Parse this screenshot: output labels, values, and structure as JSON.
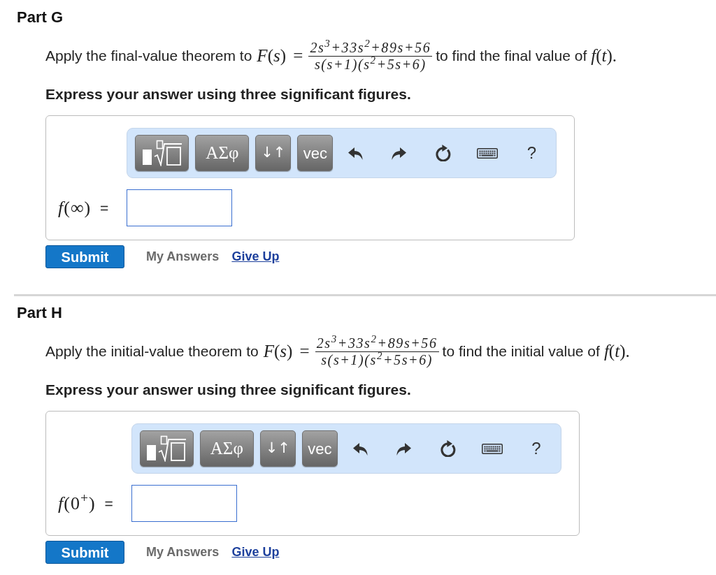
{
  "parts": [
    {
      "title": "Part G",
      "prompt": {
        "before": "Apply the final-value theorem to",
        "lhs": "*F*(*s*) =",
        "numerator": "2s$^{3}$+33s$^{2}$+89s+56",
        "denominator": "s(s+1)(s$^{2}$+5s+6)",
        "after": "to find the final value of",
        "target": "*f*(*t*)."
      },
      "instruction": "Express your answer using three significant figures.",
      "toolbar": [
        {
          "kind": "templates"
        },
        {
          "kind": "symbols",
          "label": "ΑΣφ"
        },
        {
          "kind": "arrows",
          "label": "↓↑"
        },
        {
          "kind": "vector",
          "label": "vec"
        },
        {
          "kind": "undo"
        },
        {
          "kind": "redo"
        },
        {
          "kind": "reset"
        },
        {
          "kind": "keyboard"
        },
        {
          "kind": "help",
          "label": "?"
        }
      ],
      "answer": {
        "label": "*f*(∞)",
        "relation": "="
      },
      "actions": [
        {
          "kind": "submit",
          "label": "Submit",
          "disabled": false
        },
        {
          "kind": "history",
          "label": "My Answers",
          "disabled": true
        },
        {
          "kind": "giveup",
          "label": "Give Up",
          "disabled": false
        }
      ]
    },
    {
      "title": "Part H",
      "prompt": {
        "before": "Apply the initial-value theorem to",
        "lhs": "*F*(*s*) =",
        "numerator": "2s$^{3}$+33s$^{2}$+89s+56",
        "denominator": "s(s+1)(s$^{2}$+5s+6)",
        "after": "to find the initial value of",
        "target": "*f*(*t*)."
      },
      "instruction": "Express your answer using three significant figures.",
      "toolbar": [
        {
          "kind": "templates"
        },
        {
          "kind": "symbols",
          "label": "ΑΣφ"
        },
        {
          "kind": "arrows",
          "label": "↓↑"
        },
        {
          "kind": "vector",
          "label": "vec"
        },
        {
          "kind": "undo"
        },
        {
          "kind": "redo"
        },
        {
          "kind": "reset"
        },
        {
          "kind": "keyboard"
        },
        {
          "kind": "help",
          "label": "?"
        }
      ],
      "answer": {
        "label": "*f*(0$^{+}$)",
        "relation": "="
      },
      "actions": [
        {
          "kind": "submit",
          "label": "Submit",
          "disabled": false
        },
        {
          "kind": "history",
          "label": "My Answers",
          "disabled": true
        },
        {
          "kind": "giveup",
          "label": "Give Up",
          "disabled": false
        }
      ]
    }
  ]
}
